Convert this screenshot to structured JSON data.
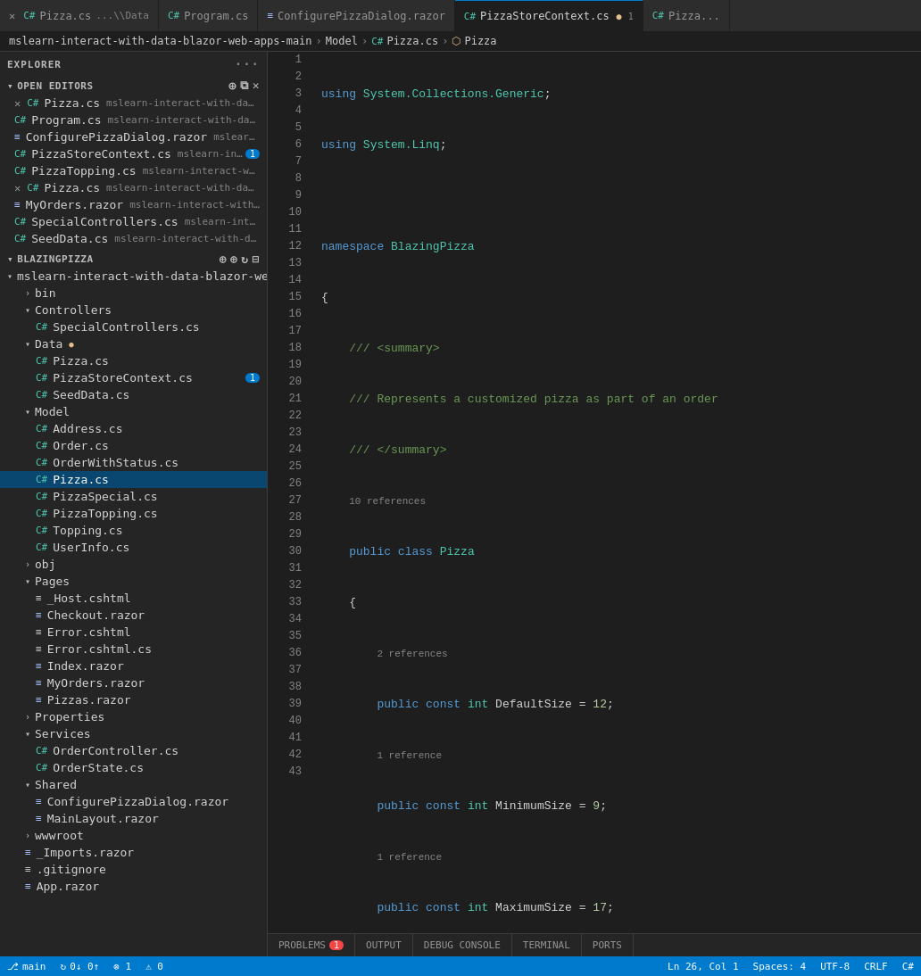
{
  "explorer": {
    "title": "EXPLORER",
    "open_editors_label": "OPEN EDITORS",
    "blazingpizza_label": "BLAZINGPIZZA"
  },
  "tabs": [
    {
      "id": "pizza-cs-1",
      "label": "Pizza.cs",
      "path": "...\\Data",
      "icon": "cs",
      "active": false,
      "modified": false,
      "closeable": true
    },
    {
      "id": "program-cs",
      "label": "Program.cs",
      "path": "",
      "icon": "cs",
      "active": false,
      "modified": false,
      "closeable": false
    },
    {
      "id": "configure-pizza",
      "label": "ConfigurePizzaDialog.razor",
      "path": "",
      "icon": "razor",
      "active": false,
      "modified": false,
      "closeable": false
    },
    {
      "id": "pizza-store-context",
      "label": "PizzaStoreContext.cs",
      "path": "",
      "icon": "cs",
      "active": true,
      "modified": true,
      "closeable": false
    },
    {
      "id": "pizza-cs-2",
      "label": "Pizza...",
      "path": "",
      "icon": "cs",
      "active": false,
      "modified": false,
      "closeable": false
    }
  ],
  "breadcrumb": {
    "items": [
      "mslearn-interact-with-data-blazor-web-apps-main",
      "Model",
      "Pizza.cs",
      "Pizza"
    ]
  },
  "open_editors": [
    {
      "name": "Pizza.cs",
      "detail": "mslearn-interact-with-data-blaz...",
      "icon": "cs",
      "modified": false
    },
    {
      "name": "Program.cs",
      "detail": "mslearn-interact-with-data-bla...",
      "icon": "cs",
      "modified": false
    },
    {
      "name": "ConfigurePizzaDialog.razor",
      "detail": "mslearn-inter...",
      "icon": "razor",
      "modified": false
    },
    {
      "name": "PizzaStoreContext.cs",
      "detail": "mslearn-inter...",
      "icon": "cs",
      "modified": true,
      "badge": "1"
    },
    {
      "name": "PizzaTopping.cs",
      "detail": "mslearn-interact-with-d...",
      "icon": "cs",
      "modified": false
    },
    {
      "name": "Pizza.cs",
      "detail": "mslearn-interact-with-data-blaz...",
      "icon": "cs",
      "modified": false
    }
  ],
  "more_open": [
    {
      "name": "MyOrders.razor",
      "detail": "mslearn-interact-with-d...",
      "icon": "razor"
    },
    {
      "name": "SpecialControllers.cs",
      "detail": "mslearn-interact-wi...",
      "icon": "cs"
    },
    {
      "name": "SeedData.cs",
      "detail": "mslearn-interact-with-d...",
      "icon": "cs"
    }
  ],
  "tree": {
    "root": "mslearn-interact-with-data-blazor-we...",
    "root_modified": true,
    "nodes": [
      {
        "id": "bin",
        "label": "bin",
        "type": "folder",
        "indent": 2,
        "expanded": false
      },
      {
        "id": "controllers",
        "label": "Controllers",
        "type": "folder",
        "indent": 1,
        "expanded": true
      },
      {
        "id": "special-controllers",
        "label": "SpecialControllers.cs",
        "type": "cs",
        "indent": 2
      },
      {
        "id": "data-folder",
        "label": "Data",
        "type": "folder",
        "indent": 1,
        "expanded": true,
        "modified": true
      },
      {
        "id": "pizza-cs-data",
        "label": "Pizza.cs",
        "type": "cs",
        "indent": 2
      },
      {
        "id": "pizza-store-ctx",
        "label": "PizzaStoreContext.cs",
        "type": "cs",
        "indent": 2,
        "badge": "1"
      },
      {
        "id": "seed-data",
        "label": "SeedData.cs",
        "type": "cs",
        "indent": 2
      },
      {
        "id": "model-folder",
        "label": "Model",
        "type": "folder",
        "indent": 1,
        "expanded": true
      },
      {
        "id": "address-cs",
        "label": "Address.cs",
        "type": "cs",
        "indent": 2
      },
      {
        "id": "order-cs",
        "label": "Order.cs",
        "type": "cs",
        "indent": 2
      },
      {
        "id": "orderwithstatus-cs",
        "label": "OrderWithStatus.cs",
        "type": "cs",
        "indent": 2
      },
      {
        "id": "pizza-cs-model",
        "label": "Pizza.cs",
        "type": "cs",
        "indent": 2,
        "active": true
      },
      {
        "id": "pizza-special-cs",
        "label": "PizzaSpecial.cs",
        "type": "cs",
        "indent": 2
      },
      {
        "id": "pizza-topping-cs",
        "label": "PizzaTopping.cs",
        "type": "cs",
        "indent": 2
      },
      {
        "id": "topping-cs",
        "label": "Topping.cs",
        "type": "cs",
        "indent": 2
      },
      {
        "id": "userinfo-cs",
        "label": "UserInfo.cs",
        "type": "cs",
        "indent": 2
      },
      {
        "id": "obj-folder",
        "label": "obj",
        "type": "folder",
        "indent": 1,
        "expanded": false
      },
      {
        "id": "pages-folder",
        "label": "Pages",
        "type": "folder",
        "indent": 1,
        "expanded": true
      },
      {
        "id": "host-cshtml",
        "label": "_Host.cshtml",
        "type": "other",
        "indent": 2
      },
      {
        "id": "checkout-razor",
        "label": "Checkout.razor",
        "type": "razor",
        "indent": 2
      },
      {
        "id": "error-cshtml",
        "label": "Error.cshtml",
        "type": "other",
        "indent": 2
      },
      {
        "id": "error-cshtml-cs",
        "label": "Error.cshtml.cs",
        "type": "other",
        "indent": 2
      },
      {
        "id": "index-razor",
        "label": "Index.razor",
        "type": "razor",
        "indent": 2
      },
      {
        "id": "myorders-razor",
        "label": "MyOrders.razor",
        "type": "razor",
        "indent": 2
      },
      {
        "id": "pizzas-razor",
        "label": "Pizzas.razor",
        "type": "razor",
        "indent": 2
      },
      {
        "id": "properties-folder",
        "label": "Properties",
        "type": "folder",
        "indent": 1,
        "expanded": false
      },
      {
        "id": "services-folder",
        "label": "Services",
        "type": "folder",
        "indent": 1,
        "expanded": true
      },
      {
        "id": "order-controller",
        "label": "OrderController.cs",
        "type": "cs",
        "indent": 2
      },
      {
        "id": "order-state",
        "label": "OrderState.cs",
        "type": "cs",
        "indent": 2
      },
      {
        "id": "shared-folder",
        "label": "Shared",
        "type": "folder",
        "indent": 1,
        "expanded": true
      },
      {
        "id": "configure-pizza-razor",
        "label": "ConfigurePizzaDialog.razor",
        "type": "razor",
        "indent": 2
      },
      {
        "id": "main-layout-razor",
        "label": "MainLayout.razor",
        "type": "razor",
        "indent": 2
      },
      {
        "id": "wwwroot-folder",
        "label": "wwwroot",
        "type": "folder",
        "indent": 1,
        "expanded": false
      },
      {
        "id": "imports-razor",
        "label": "_Imports.razor",
        "type": "razor",
        "indent": 1
      },
      {
        "id": "gitignore",
        "label": ".gitignore",
        "type": "other",
        "indent": 1
      },
      {
        "id": "app-razor",
        "label": "App.razor",
        "type": "razor",
        "indent": 1
      }
    ]
  },
  "code_lines": [
    {
      "num": 1,
      "content": "using_system_collections"
    },
    {
      "num": 2,
      "content": "using_system_linq"
    },
    {
      "num": 3,
      "content": ""
    },
    {
      "num": 4,
      "content": "namespace_blazingpizza"
    },
    {
      "num": 5,
      "content": "open_brace"
    },
    {
      "num": 6,
      "content": "summary_comment"
    },
    {
      "num": 7,
      "content": "represents_comment"
    },
    {
      "num": 8,
      "content": "end_summary_comment"
    },
    {
      "num": 9,
      "content": "ref_10"
    },
    {
      "num": 10,
      "content": "public_class_pizza"
    },
    {
      "num": 11,
      "content": "open_brace2"
    }
  ],
  "bottom_tabs": [
    {
      "label": "PROBLEMS",
      "badge": "1"
    },
    {
      "label": "OUTPUT",
      "badge": null
    },
    {
      "label": "DEBUG CONSOLE",
      "badge": null
    },
    {
      "label": "TERMINAL",
      "badge": null
    },
    {
      "label": "PORTS",
      "badge": null
    }
  ],
  "status_bar": {
    "branch": "main",
    "sync": "0↓ 0↑",
    "errors": "⊗ 1",
    "warnings": "⚠ 0",
    "line_col": "Ln 26, Col 1",
    "spaces": "Spaces: 4",
    "encoding": "UTF-8",
    "line_ending": "CRLF",
    "language": "C#"
  }
}
